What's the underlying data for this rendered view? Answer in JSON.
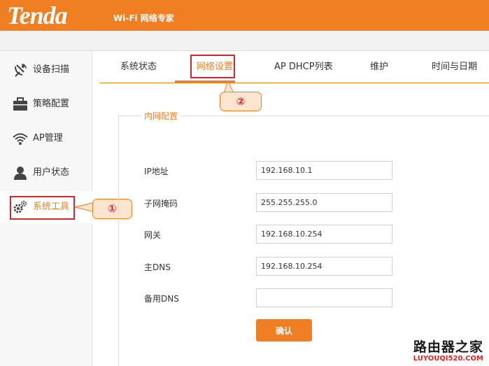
{
  "header": {
    "logo": "Tenda",
    "subtitle": "Wi-Fi 网络专家"
  },
  "sidebar": {
    "items": [
      {
        "label": "设备扫描",
        "icon": "satellite-dish-icon"
      },
      {
        "label": "策略配置",
        "icon": "briefcase-icon"
      },
      {
        "label": "AP管理",
        "icon": "wifi-icon"
      },
      {
        "label": "用户状态",
        "icon": "user-icon"
      },
      {
        "label": "系统工具",
        "icon": "gear-icon",
        "active": true
      }
    ]
  },
  "tabs": [
    {
      "label": "系统状态"
    },
    {
      "label": "网络设置",
      "active": true
    },
    {
      "label": "AP DHCP列表"
    },
    {
      "label": "维护"
    },
    {
      "label": "时间与日期"
    }
  ],
  "annotations": {
    "step1": "①",
    "step2": "②"
  },
  "section": {
    "legend": "内网配置",
    "fields": [
      {
        "label": "IP地址",
        "value": "192.168.10.1"
      },
      {
        "label": "子网掩码",
        "value": "255.255.255.0"
      },
      {
        "label": "网关",
        "value": "192.168.10.254"
      },
      {
        "label": "主DNS",
        "value": "192.168.10.254"
      },
      {
        "label": "备用DNS",
        "value": ""
      }
    ],
    "confirm_label": "确认"
  },
  "watermark": {
    "line1": "路由器之家",
    "line2": "LUYOUQI520.COM"
  },
  "colors": {
    "brand": "#f07f24",
    "highlight": "#d9232a"
  }
}
